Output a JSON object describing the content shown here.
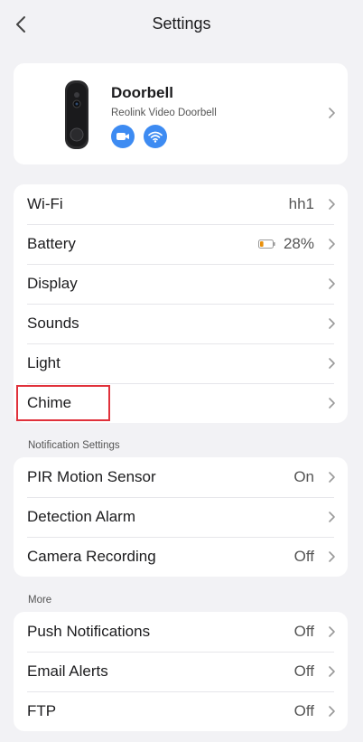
{
  "header": {
    "title": "Settings"
  },
  "device": {
    "name": "Doorbell",
    "model": "Reolink Video Doorbell",
    "badges": [
      "camera-icon",
      "wifi-icon"
    ]
  },
  "general": {
    "rows": [
      {
        "label": "Wi-Fi",
        "value": "hh1"
      },
      {
        "label": "Battery",
        "value": "28%",
        "battery_level": 0.28
      },
      {
        "label": "Display",
        "value": ""
      },
      {
        "label": "Sounds",
        "value": ""
      },
      {
        "label": "Light",
        "value": ""
      },
      {
        "label": "Chime",
        "value": ""
      }
    ]
  },
  "notification": {
    "section_label": "Notification Settings",
    "rows": [
      {
        "label": "PIR Motion Sensor",
        "value": "On"
      },
      {
        "label": "Detection Alarm",
        "value": ""
      },
      {
        "label": "Camera Recording",
        "value": "Off"
      }
    ]
  },
  "more": {
    "section_label": "More",
    "rows": [
      {
        "label": "Push Notifications",
        "value": "Off"
      },
      {
        "label": "Email Alerts",
        "value": "Off"
      },
      {
        "label": "FTP",
        "value": "Off"
      }
    ]
  },
  "colors": {
    "accent": "#3d8bf2",
    "highlight": "#e0313b",
    "battery": "#e8900c"
  }
}
